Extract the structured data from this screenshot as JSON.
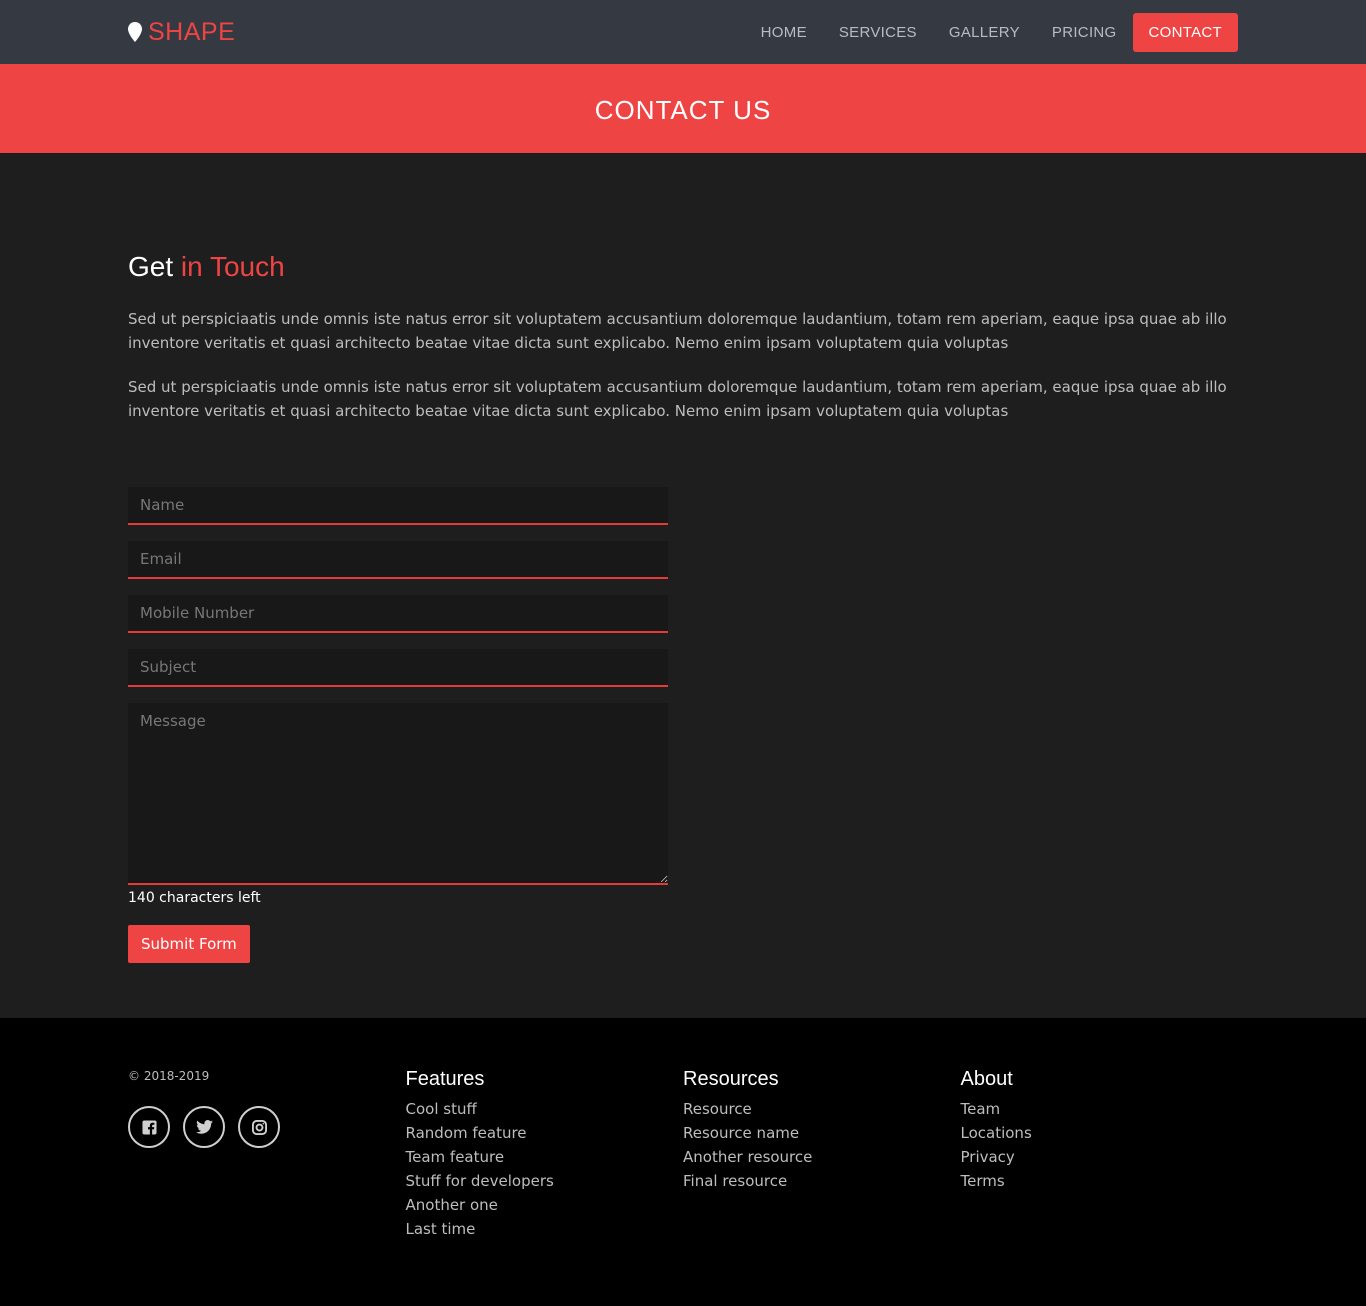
{
  "brand": {
    "name": "SHAPE",
    "color": "#ef4444",
    "icon": "map-marker-icon"
  },
  "nav": {
    "items": [
      {
        "label": "HOME"
      },
      {
        "label": "SERVICES"
      },
      {
        "label": "GALLERY"
      },
      {
        "label": "PRICING"
      },
      {
        "label": "CONTACT",
        "active": true
      }
    ]
  },
  "banner": {
    "title": "CONTACT US"
  },
  "contact": {
    "heading_plain": "Get",
    "heading_accent": "in Touch",
    "paragraphs": [
      "Sed ut perspiciaatis unde omnis iste natus error sit voluptatem accusantium doloremque laudantium, totam rem aperiam, eaque ipsa quae ab illo inventore veritatis et quasi architecto beatae vitae dicta sunt explicabo. Nemo enim ipsam voluptatem quia voluptas",
      "Sed ut perspiciaatis unde omnis iste natus error sit voluptatem accusantium doloremque laudantium, totam rem aperiam, eaque ipsa quae ab illo inventore veritatis et quasi architecto beatae vitae dicta sunt explicabo. Nemo enim ipsam voluptatem quia voluptas"
    ]
  },
  "form": {
    "name_placeholder": "Name",
    "email_placeholder": "Email",
    "mobile_placeholder": "Mobile Number",
    "subject_placeholder": "Subject",
    "message_placeholder": "Message",
    "counter": "140 characters left",
    "submit_label": "Submit Form"
  },
  "footer": {
    "copyright": "© 2018-2019",
    "social": [
      "facebook-icon",
      "twitter-icon",
      "instagram-icon"
    ],
    "features": {
      "title": "Features",
      "links": [
        "Cool stuff",
        "Random feature",
        "Team feature",
        "Stuff for developers",
        "Another one",
        "Last time"
      ]
    },
    "resources": {
      "title": "Resources",
      "links": [
        "Resource",
        "Resource name",
        "Another resource",
        "Final resource"
      ]
    },
    "about": {
      "title": "About",
      "links": [
        "Team",
        "Locations",
        "Privacy",
        "Terms"
      ]
    }
  },
  "colors": {
    "accent": "#ef4444",
    "navbar": "#353a42",
    "body": "#1e1e1f",
    "footer": "#000000"
  }
}
